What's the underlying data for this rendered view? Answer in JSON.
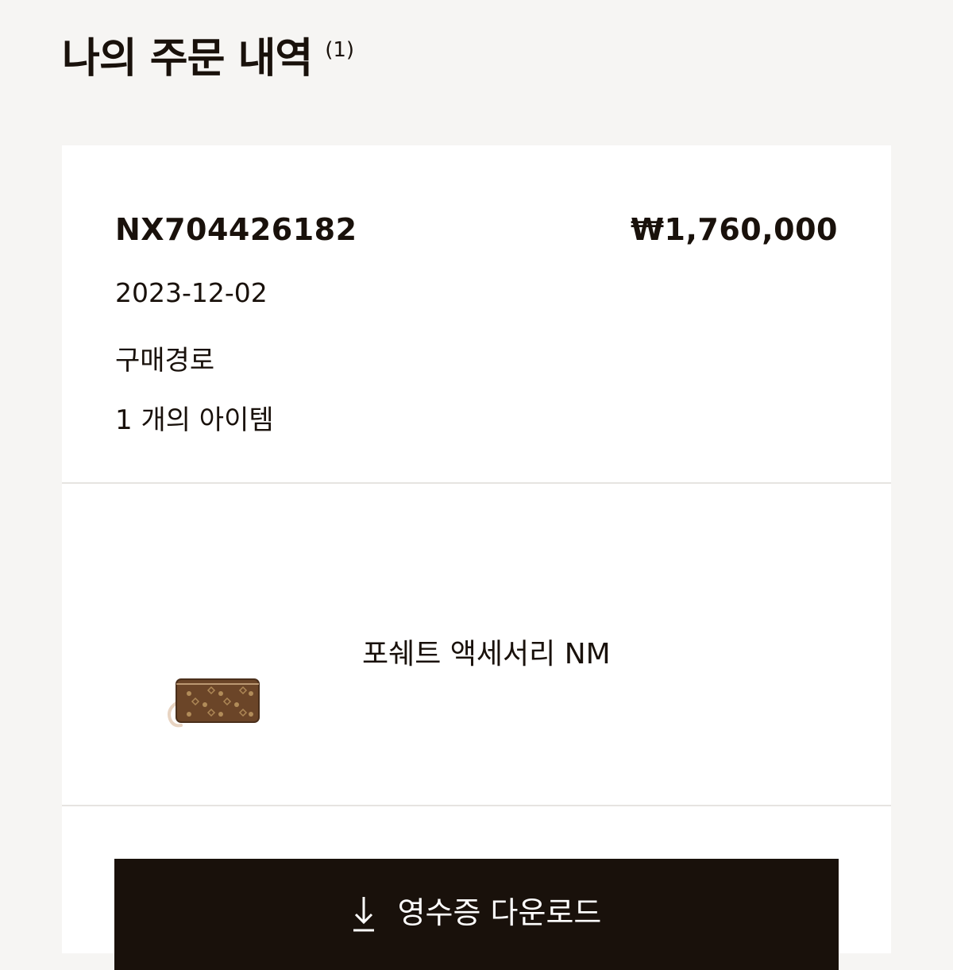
{
  "header": {
    "title": "나의 주문 내역",
    "count": "(1)"
  },
  "order": {
    "number": "NX704426182",
    "price": "₩1,760,000",
    "date": "2023-12-02",
    "channel_label": "구매경로",
    "item_count": "1 개의 아이템",
    "items": [
      {
        "name": "포쉐트 액세서리 NM",
        "image_icon": "monogram-pouch-image"
      }
    ]
  },
  "actions": {
    "download_receipt_label": "영수증 다운로드",
    "download_icon": "download-arrow-icon"
  },
  "colors": {
    "background": "#f6f5f3",
    "card": "#ffffff",
    "text": "#19110b",
    "button": "#19110b",
    "divider": "#e6e4e1",
    "monogram_brown": "#6b4528"
  }
}
